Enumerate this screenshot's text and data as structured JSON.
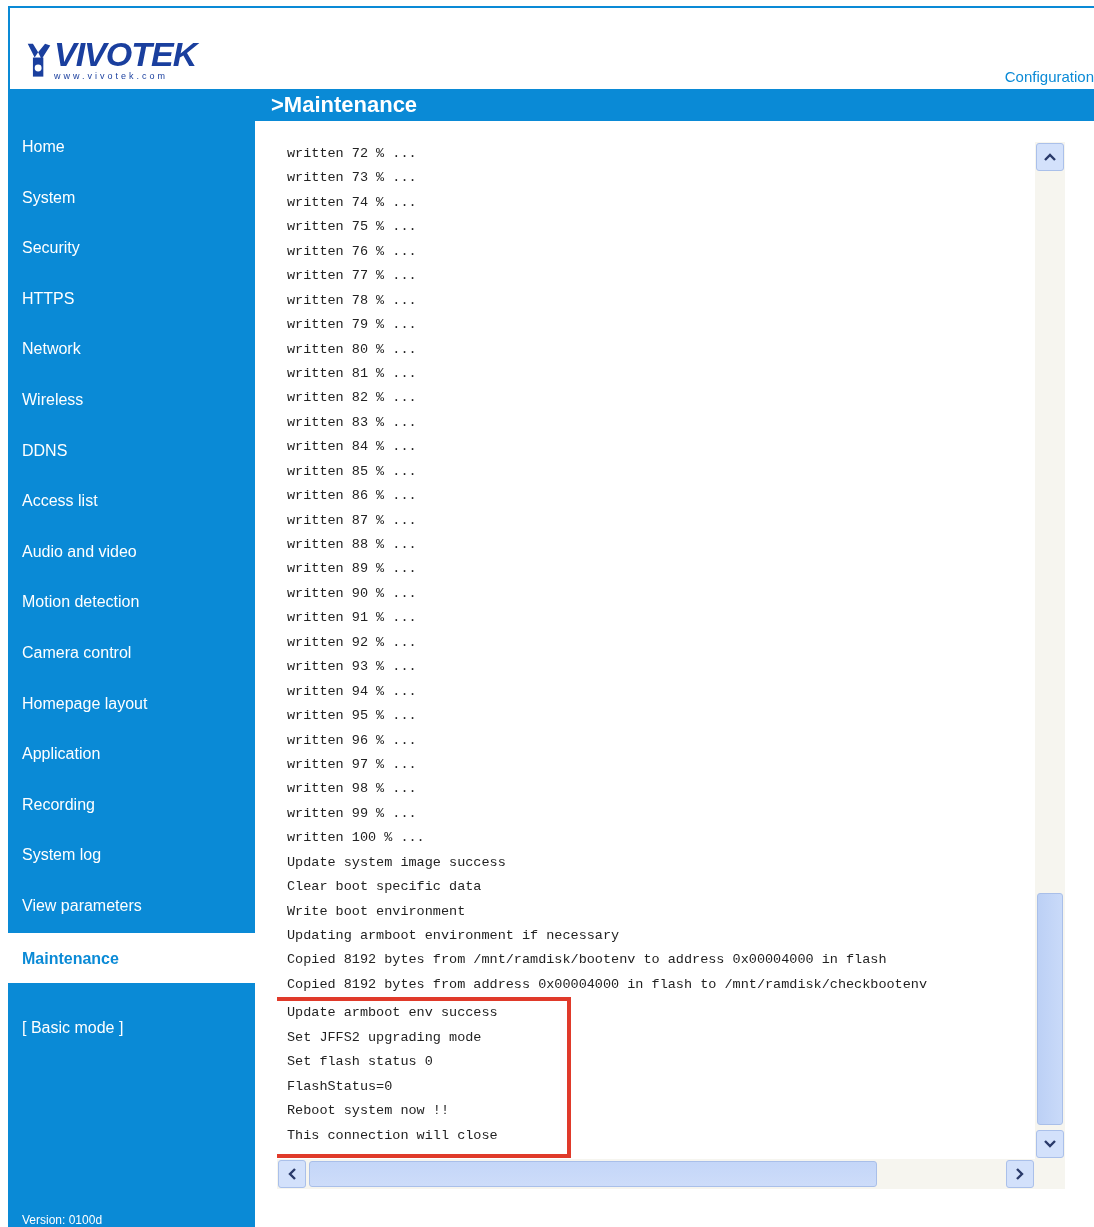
{
  "header": {
    "logo": {
      "brand": "VIVOTEK",
      "url": "www.vivotek.com"
    },
    "link": "Configuration"
  },
  "page_title": ">Maintenance",
  "sidebar": {
    "items": [
      {
        "label": "Home",
        "selected": false
      },
      {
        "label": "System",
        "selected": false
      },
      {
        "label": "Security",
        "selected": false
      },
      {
        "label": "HTTPS",
        "selected": false
      },
      {
        "label": "Network",
        "selected": false
      },
      {
        "label": "Wireless",
        "selected": false
      },
      {
        "label": "DDNS",
        "selected": false
      },
      {
        "label": "Access list",
        "selected": false
      },
      {
        "label": "Audio and video",
        "selected": false
      },
      {
        "label": "Motion detection",
        "selected": false
      },
      {
        "label": "Camera control",
        "selected": false
      },
      {
        "label": "Homepage layout",
        "selected": false
      },
      {
        "label": "Application",
        "selected": false
      },
      {
        "label": "Recording",
        "selected": false
      },
      {
        "label": "System log",
        "selected": false
      },
      {
        "label": "View parameters",
        "selected": false
      },
      {
        "label": "Maintenance",
        "selected": true
      }
    ],
    "mode_link": "[ Basic mode ]",
    "version": "Version: 0100d"
  },
  "log": {
    "lines": [
      "written 72 % ...",
      "written 73 % ...",
      "written 74 % ...",
      "written 75 % ...",
      "written 76 % ...",
      "written 77 % ...",
      "written 78 % ...",
      "written 79 % ...",
      "written 80 % ...",
      "written 81 % ...",
      "written 82 % ...",
      "written 83 % ...",
      "written 84 % ...",
      "written 85 % ...",
      "written 86 % ...",
      "written 87 % ...",
      "written 88 % ...",
      "written 89 % ...",
      "written 90 % ...",
      "written 91 % ...",
      "written 92 % ...",
      "written 93 % ...",
      "written 94 % ...",
      "written 95 % ...",
      "written 96 % ...",
      "written 97 % ...",
      "written 98 % ...",
      "written 99 % ...",
      "written 100 % ...",
      "Update system image success",
      "Clear boot specific data",
      "Write boot environment",
      "Updating armboot environment if necessary",
      "Copied 8192 bytes from /mnt/ramdisk/bootenv to address 0x00004000 in flash",
      "Copied 8192 bytes from address 0x00004000 in flash to /mnt/ramdisk/checkbootenv"
    ],
    "highlighted_lines": [
      "Update armboot env success",
      "Set JFFS2 upgrading mode",
      "Set flash status 0",
      "FlashStatus=0",
      "Reboot system now !!",
      "This connection will close"
    ]
  }
}
